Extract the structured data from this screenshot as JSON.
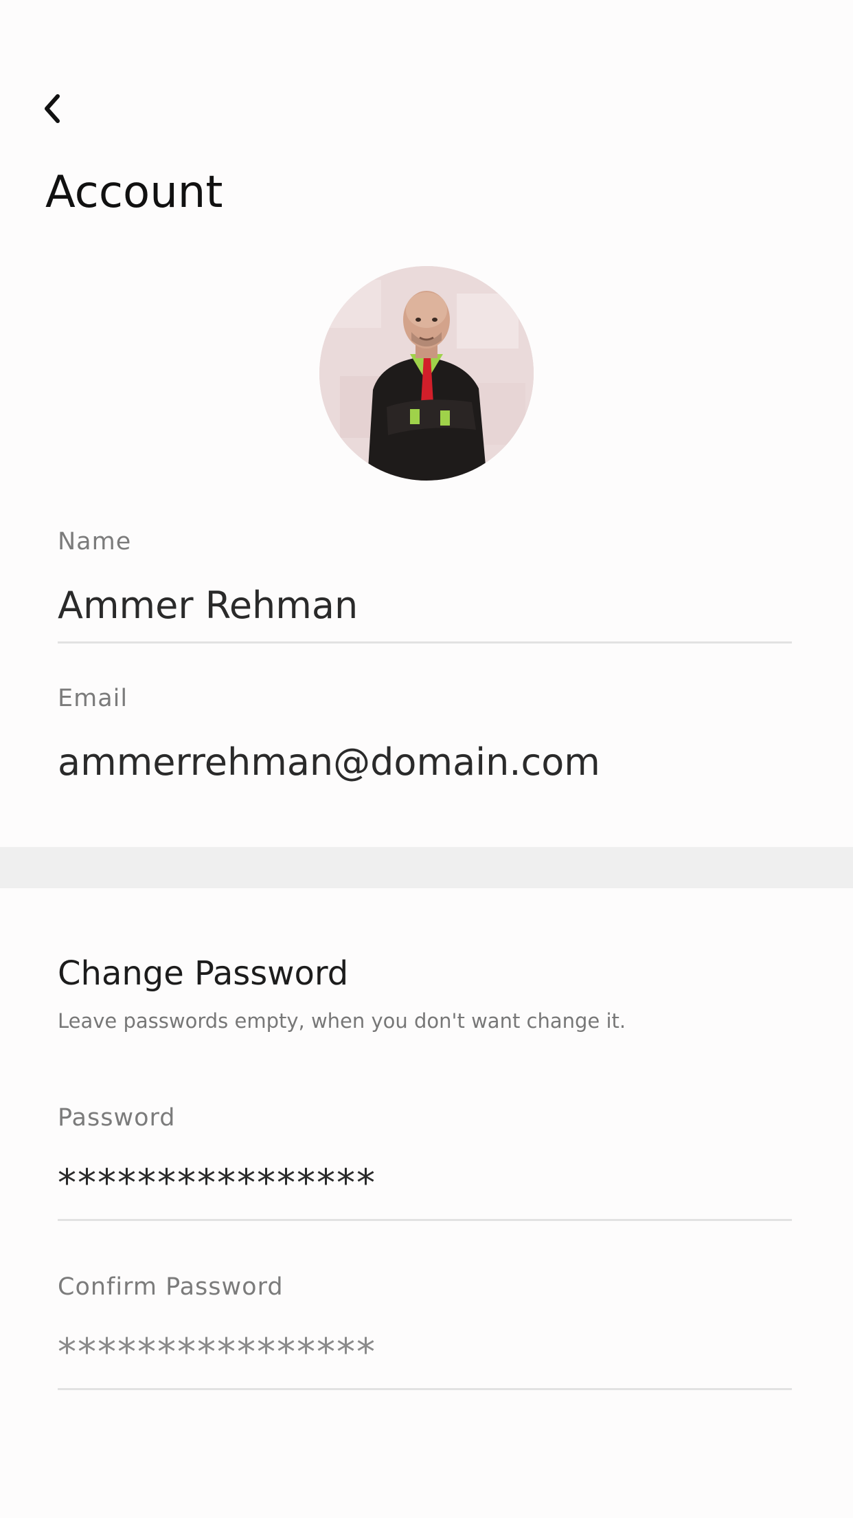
{
  "header": {
    "back_icon": "chevron-left-icon",
    "title": "Account"
  },
  "profile": {
    "avatar_alt": "profile photo"
  },
  "name_field": {
    "label": "Name",
    "value": "Ammer Rehman"
  },
  "email_field": {
    "label": "Email",
    "value": "ammerrehman@domain.com"
  },
  "password_section": {
    "title": "Change Password",
    "hint": "Leave passwords empty, when you don't want change it."
  },
  "password_field": {
    "label": "Password",
    "value": "****************"
  },
  "confirm_password_field": {
    "label": "Confirm Password",
    "value": "****************"
  },
  "colors": {
    "background": "#fdfcfc",
    "divider": "#efefef",
    "label": "#7b7b7b",
    "text": "#2a2a2a",
    "underline": "#e2e2e2"
  }
}
